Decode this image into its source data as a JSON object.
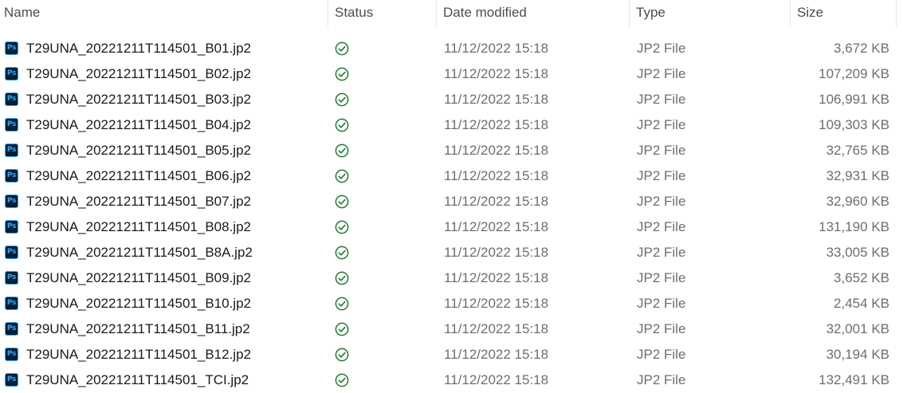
{
  "columns": {
    "name": "Name",
    "status": "Status",
    "date_modified": "Date modified",
    "type": "Type",
    "size": "Size"
  },
  "icons": {
    "file_icon": "photoshop-file-icon",
    "file_icon_text": "Ps",
    "status_icon": "synced-check-icon"
  },
  "colors": {
    "status_green": "#1e7a34",
    "ps_background": "#001e36",
    "ps_accent": "#31a8ff"
  },
  "files": [
    {
      "name": "T29UNA_20221211T114501_B01.jp2",
      "date": "11/12/2022 15:18",
      "type": "JP2 File",
      "size": "3,672 KB"
    },
    {
      "name": "T29UNA_20221211T114501_B02.jp2",
      "date": "11/12/2022 15:18",
      "type": "JP2 File",
      "size": "107,209 KB"
    },
    {
      "name": "T29UNA_20221211T114501_B03.jp2",
      "date": "11/12/2022 15:18",
      "type": "JP2 File",
      "size": "106,991 KB"
    },
    {
      "name": "T29UNA_20221211T114501_B04.jp2",
      "date": "11/12/2022 15:18",
      "type": "JP2 File",
      "size": "109,303 KB"
    },
    {
      "name": "T29UNA_20221211T114501_B05.jp2",
      "date": "11/12/2022 15:18",
      "type": "JP2 File",
      "size": "32,765 KB"
    },
    {
      "name": "T29UNA_20221211T114501_B06.jp2",
      "date": "11/12/2022 15:18",
      "type": "JP2 File",
      "size": "32,931 KB"
    },
    {
      "name": "T29UNA_20221211T114501_B07.jp2",
      "date": "11/12/2022 15:18",
      "type": "JP2 File",
      "size": "32,960 KB"
    },
    {
      "name": "T29UNA_20221211T114501_B08.jp2",
      "date": "11/12/2022 15:18",
      "type": "JP2 File",
      "size": "131,190 KB"
    },
    {
      "name": "T29UNA_20221211T114501_B8A.jp2",
      "date": "11/12/2022 15:18",
      "type": "JP2 File",
      "size": "33,005 KB"
    },
    {
      "name": "T29UNA_20221211T114501_B09.jp2",
      "date": "11/12/2022 15:18",
      "type": "JP2 File",
      "size": "3,652 KB"
    },
    {
      "name": "T29UNA_20221211T114501_B10.jp2",
      "date": "11/12/2022 15:18",
      "type": "JP2 File",
      "size": "2,454 KB"
    },
    {
      "name": "T29UNA_20221211T114501_B11.jp2",
      "date": "11/12/2022 15:18",
      "type": "JP2 File",
      "size": "32,001 KB"
    },
    {
      "name": "T29UNA_20221211T114501_B12.jp2",
      "date": "11/12/2022 15:18",
      "type": "JP2 File",
      "size": "30,194 KB"
    },
    {
      "name": "T29UNA_20221211T114501_TCI.jp2",
      "date": "11/12/2022 15:18",
      "type": "JP2 File",
      "size": "132,491 KB"
    }
  ]
}
